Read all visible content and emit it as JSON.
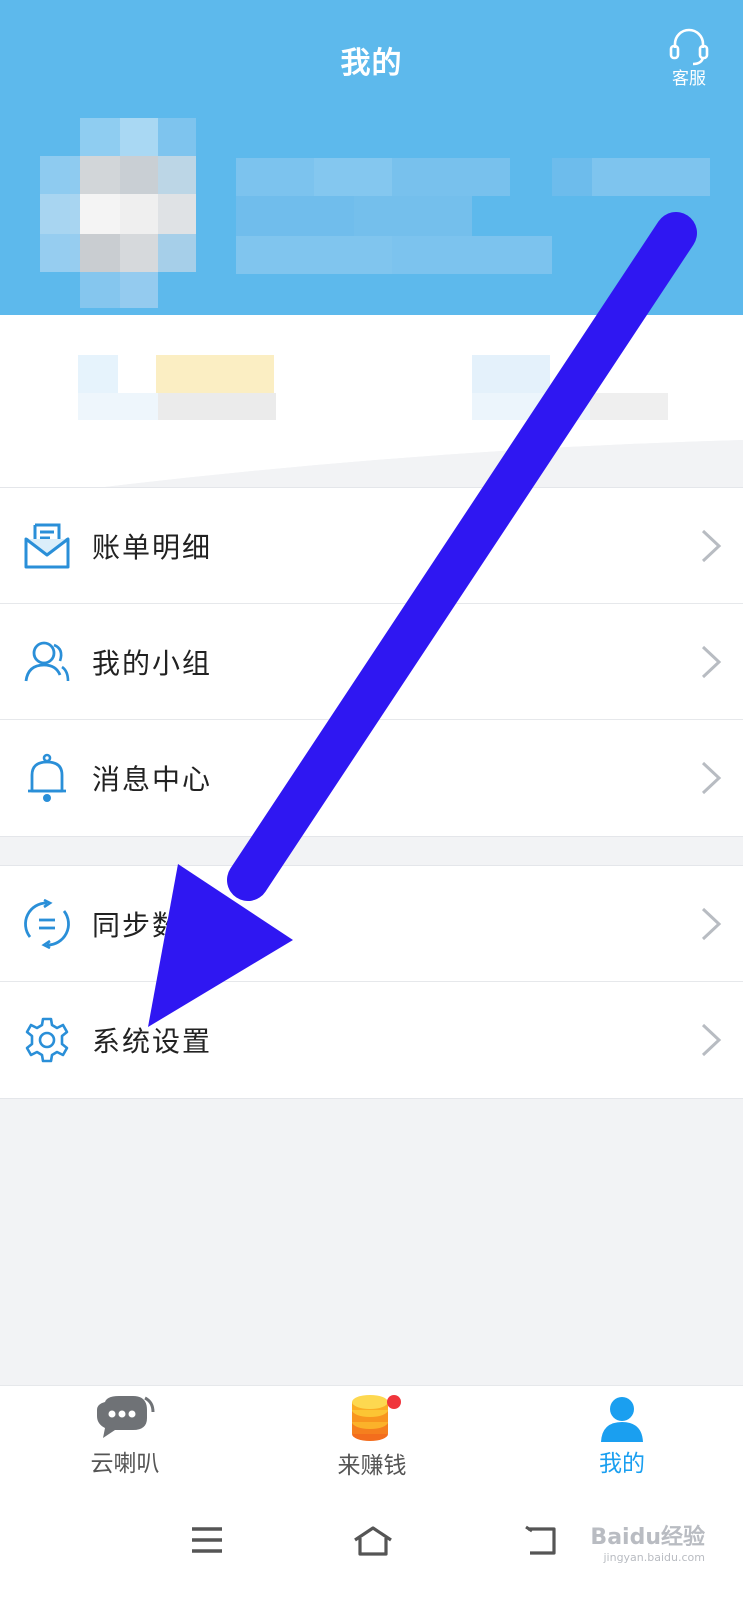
{
  "header": {
    "title": "我的",
    "service_label": "客服"
  },
  "menu": {
    "group1": [
      {
        "label": "账单明细",
        "icon": "bill-envelope-icon"
      },
      {
        "label": "我的小组",
        "icon": "group-users-icon"
      },
      {
        "label": "消息中心",
        "icon": "bell-icon"
      }
    ],
    "group2": [
      {
        "label": "同步数据",
        "icon": "sync-icon"
      },
      {
        "label": "系统设置",
        "icon": "gear-icon"
      }
    ]
  },
  "tabbar": {
    "tabs": [
      {
        "label": "云喇叭",
        "icon": "chat-bubble-icon",
        "active": false
      },
      {
        "label": "来赚钱",
        "icon": "coin-stack-icon",
        "active": false,
        "badge": true
      },
      {
        "label": "我的",
        "icon": "person-icon",
        "active": true
      }
    ]
  },
  "watermark": {
    "text": "Baidu经验",
    "sub": "jingyan.baidu.com"
  },
  "colors": {
    "header_bg": "#5db9ec",
    "accent": "#1a9ff0",
    "annotation_arrow": "#2f17f2",
    "badge": "#f0353c"
  }
}
